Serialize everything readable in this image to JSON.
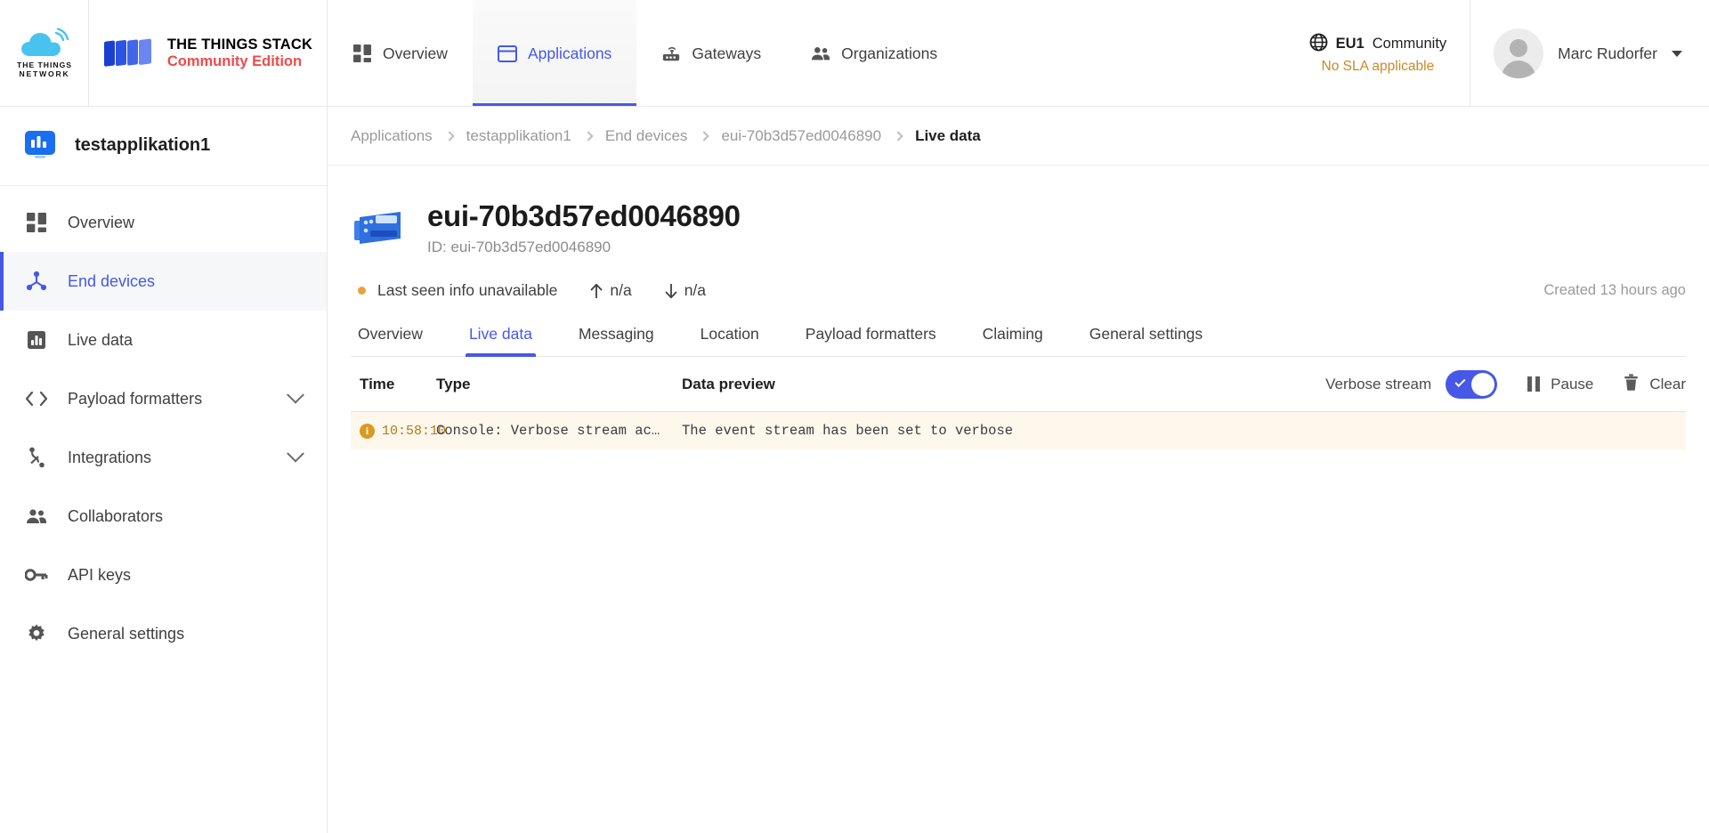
{
  "brand": {
    "network_line1": "THE THINGS",
    "network_line2": "NETWORK",
    "stack_line1": "THE THINGS STACK",
    "stack_line2": "Community Edition",
    "accent_blue": "#4658e8",
    "accent_red": "#ec4b4b",
    "accent_amber": "#c98a27"
  },
  "topnav": {
    "items": [
      {
        "label": "Overview",
        "icon": "grid-icon",
        "active": false
      },
      {
        "label": "Applications",
        "icon": "window-icon",
        "active": true
      },
      {
        "label": "Gateways",
        "icon": "router-icon",
        "active": false
      },
      {
        "label": "Organizations",
        "icon": "people-icon",
        "active": false
      }
    ],
    "cluster": {
      "icon": "globe-icon",
      "name": "EU1",
      "plan": "Community",
      "sla": "No SLA applicable"
    },
    "user": {
      "name": "Marc Rudorfer",
      "avatar": "user-avatar",
      "caret": "chevron-down-icon"
    }
  },
  "sidebar": {
    "app_name": "testapplikation1",
    "app_icon": "application-icon",
    "items": [
      {
        "label": "Overview",
        "icon": "grid-icon",
        "active": false,
        "expandable": false
      },
      {
        "label": "End devices",
        "icon": "end-device-icon",
        "active": true,
        "expandable": false
      },
      {
        "label": "Live data",
        "icon": "live-data-icon",
        "active": false,
        "expandable": false
      },
      {
        "label": "Payload formatters",
        "icon": "code-icon",
        "active": false,
        "expandable": true
      },
      {
        "label": "Integrations",
        "icon": "integration-icon",
        "active": false,
        "expandable": true
      },
      {
        "label": "Collaborators",
        "icon": "people-icon",
        "active": false,
        "expandable": false
      },
      {
        "label": "API keys",
        "icon": "key-icon",
        "active": false,
        "expandable": false
      },
      {
        "label": "General settings",
        "icon": "gear-icon",
        "active": false,
        "expandable": false
      }
    ]
  },
  "breadcrumb": [
    {
      "label": "Applications",
      "current": false
    },
    {
      "label": "testapplikation1",
      "current": false
    },
    {
      "label": "End devices",
      "current": false
    },
    {
      "label": "eui-70b3d57ed0046890",
      "current": false
    },
    {
      "label": "Live data",
      "current": true
    }
  ],
  "device": {
    "icon": "device-board-icon",
    "title": "eui-70b3d57ed0046890",
    "id_label": "ID: eui-70b3d57ed0046890",
    "status_text": "Last seen info unavailable",
    "status_dot_color": "#e8a33d",
    "uplink": {
      "icon": "arrow-up-icon",
      "value": "n/a"
    },
    "downlink": {
      "icon": "arrow-down-icon",
      "value": "n/a"
    },
    "created": "Created 13 hours ago"
  },
  "tabs": [
    {
      "label": "Overview",
      "active": false
    },
    {
      "label": "Live data",
      "active": true
    },
    {
      "label": "Messaging",
      "active": false
    },
    {
      "label": "Location",
      "active": false
    },
    {
      "label": "Payload formatters",
      "active": false
    },
    {
      "label": "Claiming",
      "active": false
    },
    {
      "label": "General settings",
      "active": false
    }
  ],
  "live_data": {
    "columns": {
      "time": "Time",
      "type": "Type",
      "preview": "Data preview"
    },
    "controls": {
      "verbose_label": "Verbose stream",
      "verbose_on": true,
      "pause_label": "Pause",
      "pause_icon": "pause-icon",
      "clear_label": "Clear",
      "clear_icon": "trash-icon"
    },
    "rows": [
      {
        "severity": "info",
        "severity_glyph": "i",
        "time": "10:58:10",
        "type": "Console: Verbose stream ac…",
        "preview": "The event stream has been set to verbose"
      }
    ]
  }
}
